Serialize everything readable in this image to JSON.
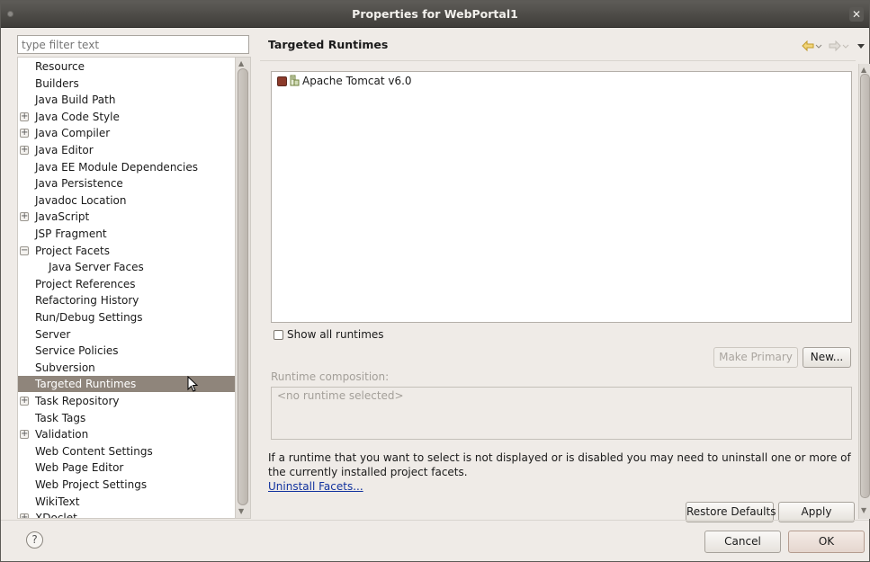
{
  "window": {
    "title": "Properties for WebPortal1"
  },
  "sidebar": {
    "filter_placeholder": "type filter text",
    "items": [
      {
        "label": "Resource"
      },
      {
        "label": "Builders"
      },
      {
        "label": "Java Build Path"
      },
      {
        "label": "Java Code Style",
        "expander": "+"
      },
      {
        "label": "Java Compiler",
        "expander": "+"
      },
      {
        "label": "Java Editor",
        "expander": "+"
      },
      {
        "label": "Java EE Module Dependencies"
      },
      {
        "label": "Java Persistence"
      },
      {
        "label": "Javadoc Location"
      },
      {
        "label": "JavaScript",
        "expander": "+"
      },
      {
        "label": "JSP Fragment"
      },
      {
        "label": "Project Facets",
        "expander": "−"
      },
      {
        "label": "Java Server Faces",
        "child": true
      },
      {
        "label": "Project References"
      },
      {
        "label": "Refactoring History"
      },
      {
        "label": "Run/Debug Settings"
      },
      {
        "label": "Server"
      },
      {
        "label": "Service Policies"
      },
      {
        "label": "Subversion"
      },
      {
        "label": "Targeted Runtimes",
        "selected": true
      },
      {
        "label": "Task Repository",
        "expander": "+"
      },
      {
        "label": "Task Tags"
      },
      {
        "label": "Validation",
        "expander": "+"
      },
      {
        "label": "Web Content Settings"
      },
      {
        "label": "Web Page Editor"
      },
      {
        "label": "Web Project Settings"
      },
      {
        "label": "WikiText"
      },
      {
        "label": "XDoclet",
        "expander": "+"
      }
    ]
  },
  "main": {
    "heading": "Targeted Runtimes",
    "runtimes": [
      {
        "label": "Apache Tomcat v6.0",
        "checked": true
      }
    ],
    "show_all_label": "Show all runtimes",
    "make_primary_label": "Make Primary",
    "new_label": "New...",
    "composition_label": "Runtime composition:",
    "composition_value": "<no runtime selected>",
    "info_text": "If a runtime that you want to select is not displayed or is disabled you may need to uninstall one or more of the currently installed project facets.",
    "uninstall_link": "Uninstall Facets...",
    "restore_defaults_label": "Restore Defaults",
    "apply_label": "Apply"
  },
  "footer": {
    "cancel_label": "Cancel",
    "ok_label": "OK",
    "help_icon": "?"
  },
  "colors": {
    "selection": "#8f857b",
    "titlebar": "#4a4844",
    "link": "#11329e",
    "checkbox_checked": "#8b3a2a"
  }
}
